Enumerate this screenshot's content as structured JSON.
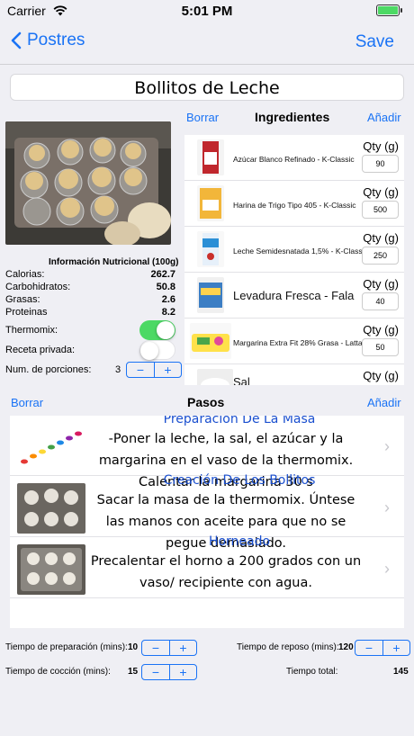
{
  "status": {
    "carrier": "Carrier",
    "time": "5:01 PM"
  },
  "nav": {
    "back_label": "Postres",
    "save_label": "Save"
  },
  "recipe_title": "Bollitos de Leche",
  "nutrition": {
    "title": "Información Nutricional (100g)",
    "rows": [
      {
        "label": "Calorias:",
        "value": "262.7"
      },
      {
        "label": "Carbohidratos:",
        "value": "50.8"
      },
      {
        "label": "Grasas:",
        "value": "2.6"
      },
      {
        "label": "Proteinas",
        "value": "8.2"
      }
    ]
  },
  "thermomix": {
    "label": "Thermomix:",
    "on": true
  },
  "private": {
    "label": "Receta privada:",
    "on": false
  },
  "portions": {
    "label": "Num. de porciones:",
    "value": "3"
  },
  "ingredients_header": {
    "delete": "Borrar",
    "title": "Ingredientes",
    "add": "Añadir"
  },
  "ingredients": [
    {
      "name": "Azúcar Blanco Refinado - K-Classic",
      "qty_label": "Qty (g)",
      "qty": "90",
      "icon": "sugar-package"
    },
    {
      "name": "Harina de Trigo Tipo 405 - K-Classic",
      "qty_label": "Qty (g)",
      "qty": "500",
      "icon": "flour-package"
    },
    {
      "name": "Leche Semidesnatada 1,5% - K-Classic",
      "qty_label": "Qty (g)",
      "qty": "250",
      "icon": "milk-carton"
    },
    {
      "name": "Levadura Fresca - Fala",
      "qty_label": "Qty (g)",
      "qty": "40",
      "icon": "yeast-package"
    },
    {
      "name": "Margarina Extra Fit 28% Grasa - Latta",
      "qty_label": "Qty (g)",
      "qty": "50",
      "icon": "margarine-tub"
    },
    {
      "name": "Sal",
      "qty_label": "Qty (g)",
      "qty": "",
      "icon": "salt"
    }
  ],
  "steps_header": {
    "delete": "Borrar",
    "title": "Pasos",
    "add": "Añadir"
  },
  "steps": [
    {
      "title": "Preparación De La Masa",
      "text": "-Poner la leche, la sal, el azúcar y la margarina en el vaso de la thermomix. Calentar la margarina 30 s"
    },
    {
      "title": "Creación De Los Bollitos",
      "text": "Sacar la masa de la thermomix. Úntese las manos con aceite para que no se pegue demasiado."
    },
    {
      "title": "Horneado",
      "text": "Precalentar el horno a 200 grados con un vaso/ recipiente con agua."
    }
  ],
  "times": {
    "prep_label": "Tiempo de preparación (mins):",
    "prep_value": "10",
    "rest_label": "Tiempo de reposo (mins):",
    "rest_value": "120",
    "cook_label": "Tiempo de cocción (mins):",
    "cook_value": "15",
    "total_label": "Tiempo total:",
    "total_value": "145"
  },
  "colors": {
    "accent": "#1a73f5",
    "toggle_on": "#4cd964",
    "background": "#efeff4"
  }
}
